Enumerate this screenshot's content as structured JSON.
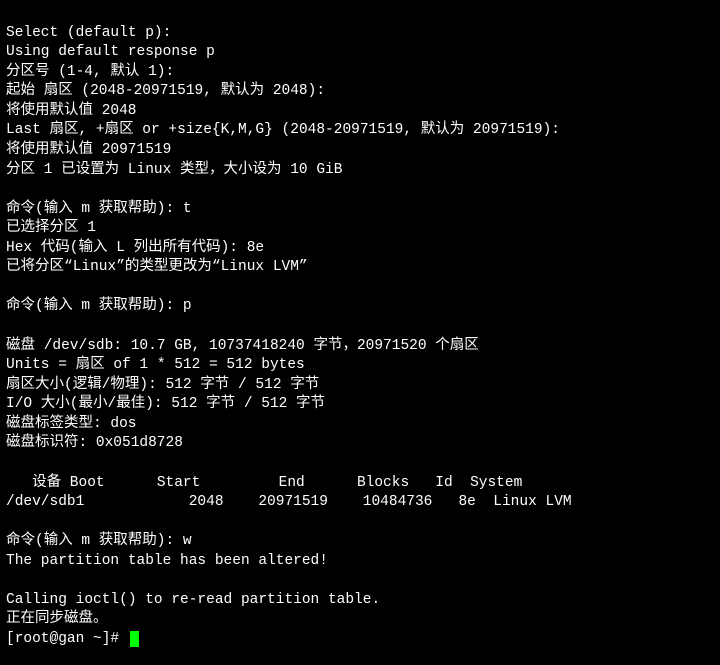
{
  "lines": [
    "Select (default p):",
    "Using default response p",
    "分区号 (1-4, 默认 1):",
    "起始 扇区 (2048-20971519, 默认为 2048):",
    "将使用默认值 2048",
    "Last 扇区, +扇区 or +size{K,M,G} (2048-20971519, 默认为 20971519):",
    "将使用默认值 20971519",
    "分区 1 已设置为 Linux 类型，大小设为 10 GiB",
    "",
    "命令(输入 m 获取帮助): t",
    "已选择分区 1",
    "Hex 代码(输入 L 列出所有代码): 8e",
    "已将分区“Linux”的类型更改为“Linux LVM”",
    "",
    "命令(输入 m 获取帮助): p",
    "",
    "磁盘 /dev/sdb: 10.7 GB, 10737418240 字节，20971520 个扇区",
    "Units = 扇区 of 1 * 512 = 512 bytes",
    "扇区大小(逻辑/物理): 512 字节 / 512 字节",
    "I/O 大小(最小/最佳): 512 字节 / 512 字节",
    "磁盘标签类型: dos",
    "磁盘标识符: 0x051d8728",
    "",
    "   设备 Boot      Start         End      Blocks   Id  System",
    "/dev/sdb1            2048    20971519    10484736   8e  Linux LVM",
    "",
    "命令(输入 m 获取帮助): w",
    "The partition table has been altered!",
    "",
    "Calling ioctl() to re-read partition table.",
    "正在同步磁盘。"
  ],
  "prompt": "[root@gan ~]# "
}
